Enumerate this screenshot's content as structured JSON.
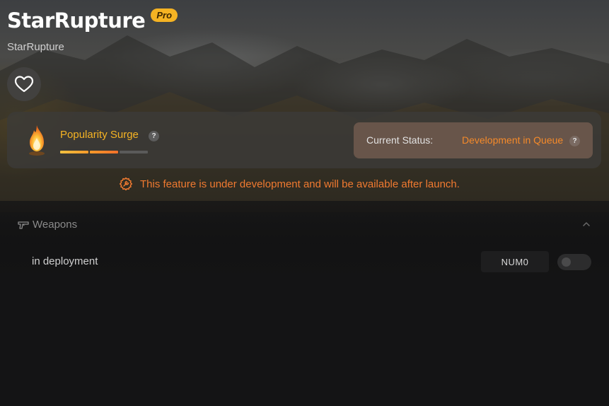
{
  "header": {
    "title": "StarRupture",
    "badge": "Pro",
    "subtitle": "StarRupture"
  },
  "favorite": {
    "icon": "heart-outline-icon"
  },
  "popularity": {
    "label": "Popularity Surge",
    "help": "?",
    "icon": "flame-icon",
    "level": 2,
    "max_level": 3
  },
  "status": {
    "label": "Current Status:",
    "value": "Development in Queue",
    "help": "?"
  },
  "notice": {
    "text": "This feature is under development and will be available after launch.",
    "icon": "gear-wrench-icon"
  },
  "section": {
    "title": "Weapons",
    "icon": "gun-icon",
    "collapse_icon": "chevron-up-icon",
    "rows": [
      {
        "label": "in deployment",
        "hotkey": "NUM0",
        "toggle_on": false
      }
    ]
  },
  "colors": {
    "accent": "#f5b323",
    "warning": "#f07a30"
  }
}
